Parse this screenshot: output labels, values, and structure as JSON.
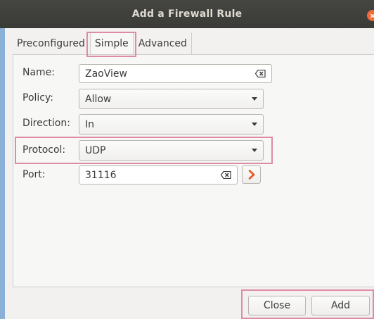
{
  "window": {
    "title": "Add a Firewall Rule"
  },
  "tabs": [
    {
      "label": "Preconfigured"
    },
    {
      "label": "Simple"
    },
    {
      "label": "Advanced"
    }
  ],
  "form": {
    "name": {
      "label": "Name:",
      "value": "ZaoView"
    },
    "policy": {
      "label": "Policy:",
      "value": "Allow"
    },
    "direction": {
      "label": "Direction:",
      "value": "In"
    },
    "protocol": {
      "label": "Protocol:",
      "value": "UDP"
    },
    "port": {
      "label": "Port:",
      "value": "31116"
    }
  },
  "buttons": {
    "close": "Close",
    "add": "Add"
  },
  "colors": {
    "highlight": "#de8ca6",
    "accent_arrow": "#e95420",
    "titlebar": "#3d3d39"
  }
}
